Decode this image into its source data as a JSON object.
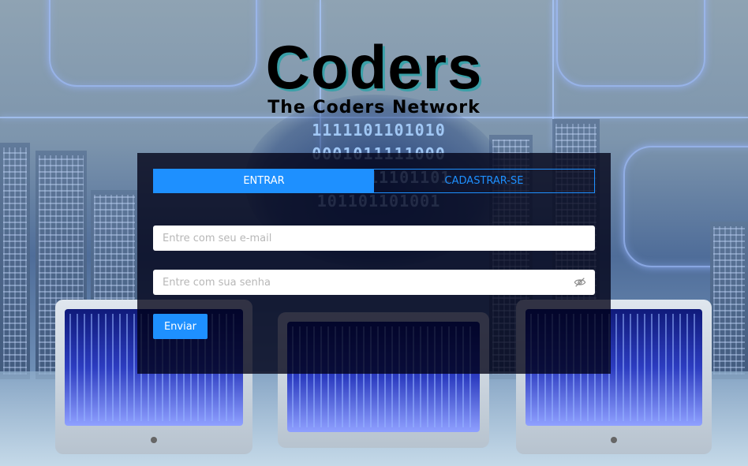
{
  "header": {
    "title": "Coders",
    "subtitle": "The Coders Network"
  },
  "tabs": [
    {
      "label": "ENTRAR",
      "active": true
    },
    {
      "label": "CADASTRAR-SE",
      "active": false
    }
  ],
  "form": {
    "email_placeholder": "Entre com seu e-mail",
    "email_value": "",
    "password_placeholder": "Entre com sua senha",
    "password_value": "",
    "password_toggle_icon": "eye-off-icon",
    "submit_label": "Enviar"
  },
  "colors": {
    "accent": "#1e90ff",
    "panel_bg": "#000014",
    "title_shadow": "#3aa0a8"
  }
}
